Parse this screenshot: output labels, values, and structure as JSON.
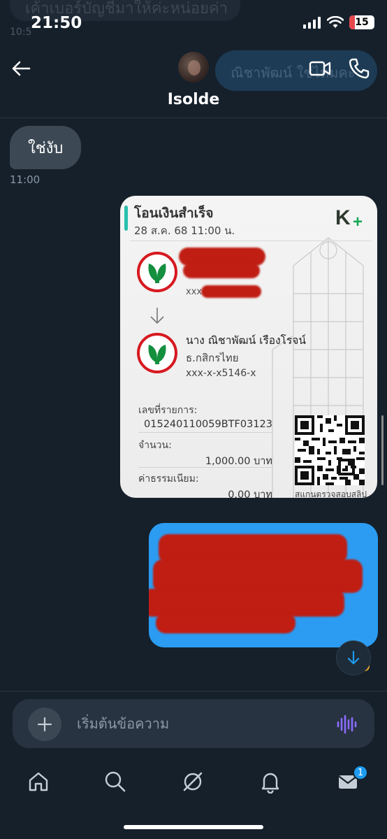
{
  "status_bar": {
    "time": "21:50",
    "battery": "15"
  },
  "background_ghost": {
    "top_text": "เค้าเบอร์บัญชีมาให้ค่ะหน่อยค่า",
    "top_time": "10:5",
    "bubble_text": "ณิชาพัฒน์ ใช่ไหมคะ"
  },
  "header": {
    "contact_name": "Isolde"
  },
  "messages": {
    "received_text": "ใช่งับ",
    "received_time": "11:00"
  },
  "slip": {
    "title": "โอนเงินสำเร็จ",
    "date": "28 ส.ค. 68  11:00 น.",
    "sender_account": "xxx-",
    "receiver_name": "นาง ณิชาพัฒน์ เรืองโรจน์",
    "receiver_bank": "ธ.กสิกรไทย",
    "receiver_account": "xxx-x-x5146-x",
    "ref_label": "เลขที่รายการ:",
    "ref_value": "015240110059BTF03123",
    "amount_label": "จำนวน:",
    "amount_value": "1,000.00 บาท",
    "fee_label": "ค่าธรรมเนียม:",
    "fee_value": "0.00 บาท",
    "qr_caption": "สแกนตรวจสอบสลิป",
    "brand": "K+"
  },
  "composer": {
    "placeholder": "เริ่มต้นข้อความ"
  },
  "nav": {
    "messages_badge": "1"
  },
  "colors": {
    "background": "#15202b",
    "accent": "#1d9bf0",
    "received_bubble": "#3c4954",
    "kbank_green": "#138f3e",
    "redaction": "#c01d13"
  }
}
